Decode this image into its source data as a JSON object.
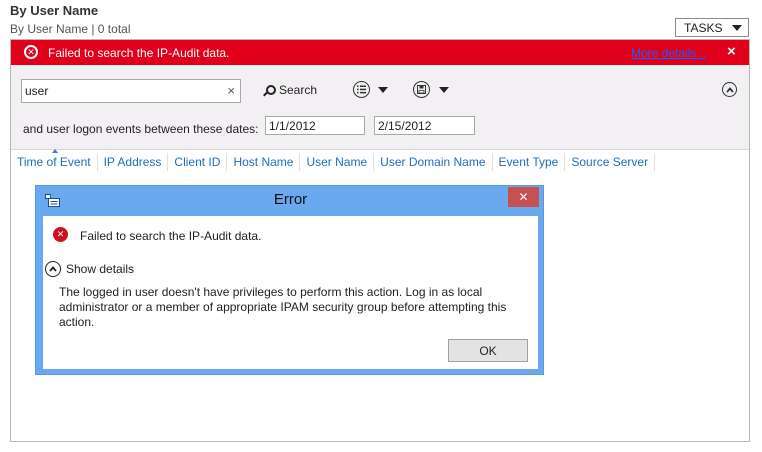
{
  "header": {
    "title": "By User Name",
    "subtitle": "By User Name | 0 total",
    "tasks_label": "TASKS"
  },
  "error_bar": {
    "message": "Failed to search the IP-Audit data.",
    "more_details": "More details...",
    "close": "×",
    "color": "#e0001a"
  },
  "search": {
    "query": "user",
    "clear": "×",
    "button_label": "Search",
    "date_label": "and user logon events between these dates:",
    "start_date": "1/1/2012",
    "end_date": "2/15/2012"
  },
  "columns": [
    "Time of Event",
    "IP Address",
    "Client ID",
    "Host Name",
    "User Name",
    "User Domain Name",
    "Event Type",
    "Source Server"
  ],
  "dialog": {
    "title": "Error",
    "close": "✕",
    "message": "Failed to search the IP-Audit data.",
    "show_details": "Show details",
    "detail": "The logged in user doesn't have privileges to perform this action. Log in as local administrator or a member of appropriate IPAM security group before attempting this action.",
    "ok_label": "OK",
    "title_bar_color": "#6aa8ef"
  },
  "icons": {
    "error": "error-icon",
    "search": "search-icon",
    "view": "list-view-icon",
    "save": "save-icon",
    "collapse": "chevron-up-icon"
  }
}
